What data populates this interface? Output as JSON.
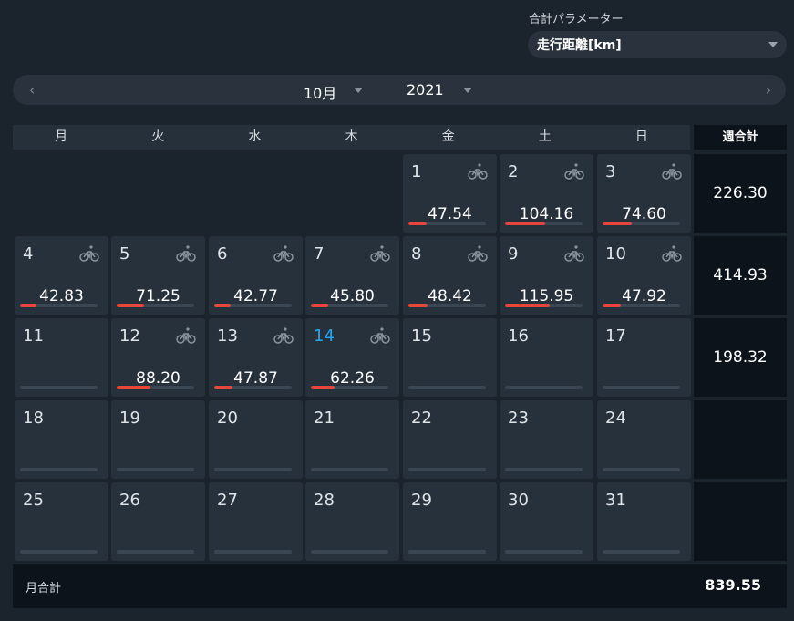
{
  "parameter": {
    "label": "合計パラメーター",
    "selected": "走行距離[km]"
  },
  "nav": {
    "prev": "‹",
    "next": "›",
    "month": "10月",
    "year": "2021"
  },
  "weekdays": [
    "月",
    "火",
    "水",
    "木",
    "金",
    "土",
    "日"
  ],
  "week_total_header": "週合計",
  "max_value": 200,
  "weeks": [
    {
      "days": [
        null,
        null,
        null,
        null,
        {
          "day": "1",
          "value": "47.54",
          "bike": true,
          "fill": 0.2377
        },
        {
          "day": "2",
          "value": "104.16",
          "bike": true,
          "fill": 0.5208
        },
        {
          "day": "3",
          "value": "74.60",
          "bike": true,
          "fill": 0.373
        }
      ],
      "total": "226.30"
    },
    {
      "days": [
        {
          "day": "4",
          "value": "42.83",
          "bike": true,
          "fill": 0.21415
        },
        {
          "day": "5",
          "value": "71.25",
          "bike": true,
          "fill": 0.35625
        },
        {
          "day": "6",
          "value": "42.77",
          "bike": true,
          "fill": 0.21385
        },
        {
          "day": "7",
          "value": "45.80",
          "bike": true,
          "fill": 0.229
        },
        {
          "day": "8",
          "value": "48.42",
          "bike": true,
          "fill": 0.2421
        },
        {
          "day": "9",
          "value": "115.95",
          "bike": true,
          "fill": 0.57975
        },
        {
          "day": "10",
          "value": "47.92",
          "bike": true,
          "fill": 0.2396
        }
      ],
      "total": "414.93"
    },
    {
      "days": [
        {
          "day": "11",
          "value": "",
          "bike": false,
          "fill": 0
        },
        {
          "day": "12",
          "value": "88.20",
          "bike": true,
          "fill": 0.441
        },
        {
          "day": "13",
          "value": "47.87",
          "bike": true,
          "fill": 0.23935
        },
        {
          "day": "14",
          "value": "62.26",
          "bike": true,
          "fill": 0.3113,
          "today": true
        },
        {
          "day": "15",
          "value": "",
          "bike": false,
          "fill": 0
        },
        {
          "day": "16",
          "value": "",
          "bike": false,
          "fill": 0
        },
        {
          "day": "17",
          "value": "",
          "bike": false,
          "fill": 0
        }
      ],
      "total": "198.32"
    },
    {
      "days": [
        {
          "day": "18",
          "value": "",
          "bike": false,
          "fill": 0
        },
        {
          "day": "19",
          "value": "",
          "bike": false,
          "fill": 0
        },
        {
          "day": "20",
          "value": "",
          "bike": false,
          "fill": 0
        },
        {
          "day": "21",
          "value": "",
          "bike": false,
          "fill": 0
        },
        {
          "day": "22",
          "value": "",
          "bike": false,
          "fill": 0
        },
        {
          "day": "23",
          "value": "",
          "bike": false,
          "fill": 0
        },
        {
          "day": "24",
          "value": "",
          "bike": false,
          "fill": 0
        }
      ],
      "total": ""
    },
    {
      "days": [
        {
          "day": "25",
          "value": "",
          "bike": false,
          "fill": 0
        },
        {
          "day": "26",
          "value": "",
          "bike": false,
          "fill": 0
        },
        {
          "day": "27",
          "value": "",
          "bike": false,
          "fill": 0
        },
        {
          "day": "28",
          "value": "",
          "bike": false,
          "fill": 0
        },
        {
          "day": "29",
          "value": "",
          "bike": false,
          "fill": 0
        },
        {
          "day": "30",
          "value": "",
          "bike": false,
          "fill": 0
        },
        {
          "day": "31",
          "value": "",
          "bike": false,
          "fill": 0
        }
      ],
      "total": ""
    }
  ],
  "month_total": {
    "label": "月合計",
    "value": "839.55"
  },
  "icons": {
    "bike": "bicycle-icon",
    "prev": "chevron-left-icon",
    "next": "chevron-right-icon",
    "dropdown": "chevron-down-icon"
  },
  "colors": {
    "accent_bar": "#e5453b",
    "today": "#2aa4ee",
    "bike_icon": "#8a949e"
  }
}
